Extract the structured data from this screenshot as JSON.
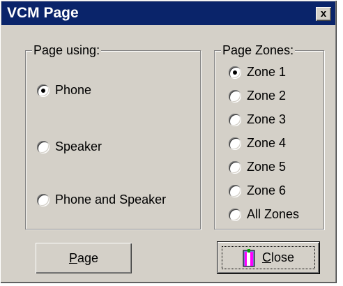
{
  "window": {
    "title": "VCM Page",
    "close_glyph": "x"
  },
  "page_using": {
    "label": "Page using:",
    "options": [
      {
        "label": "Phone",
        "selected": true
      },
      {
        "label": "Speaker",
        "selected": false
      },
      {
        "label": "Phone and Speaker",
        "selected": false
      }
    ]
  },
  "page_zones": {
    "label": "Page Zones:",
    "options": [
      {
        "label": "Zone 1",
        "selected": true
      },
      {
        "label": "Zone 2",
        "selected": false
      },
      {
        "label": "Zone 3",
        "selected": false
      },
      {
        "label": "Zone 4",
        "selected": false
      },
      {
        "label": "Zone 5",
        "selected": false
      },
      {
        "label": "Zone 6",
        "selected": false
      },
      {
        "label": "All Zones",
        "selected": false
      }
    ]
  },
  "buttons": {
    "page_first": "P",
    "page_rest": "age",
    "close_first": "C",
    "close_rest": "lose",
    "close_icon": "door-icon"
  }
}
